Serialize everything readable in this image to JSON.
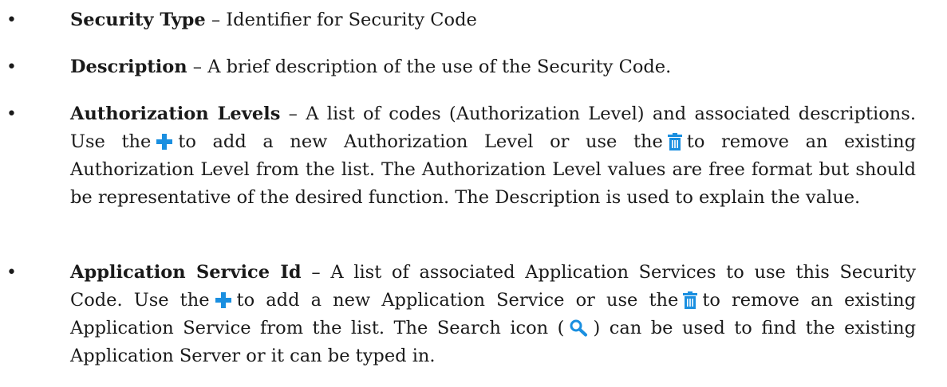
{
  "bullet_glyph": "•",
  "items": [
    {
      "term": "Security Type",
      "sep": " – ",
      "text": "Identifier for Security Code"
    },
    {
      "term": "Description",
      "sep": " – ",
      "text": "A brief description of the use of the Security Code."
    },
    {
      "term": "Authorization Levels",
      "sep": " – ",
      "text_a": "A list of codes (Authorization Level) and associated descriptions. Use the",
      "text_b": "to add a new Authorization Level or use the",
      "text_c": "to remove an existing Authorization Level from the list. The Authorization Level values are free format but should be representative of the desired function. The Description is used to explain the value."
    },
    {
      "term": "Application Service Id",
      "sep": " – ",
      "text_a": "A list of associated Application Services to use this Security Code. Use the",
      "text_b": "to add a new Application Service or use the",
      "text_c": "to remove an existing Application Service from the list. The Search icon (",
      "text_d": ") can be used to find the existing Application Server or it can be typed in."
    }
  ],
  "icons": {
    "add": "plus-icon",
    "remove": "trash-icon",
    "search": "search-icon"
  },
  "colors": {
    "icon_blue": "#1a8fe0",
    "text": "#1a1a1a"
  }
}
